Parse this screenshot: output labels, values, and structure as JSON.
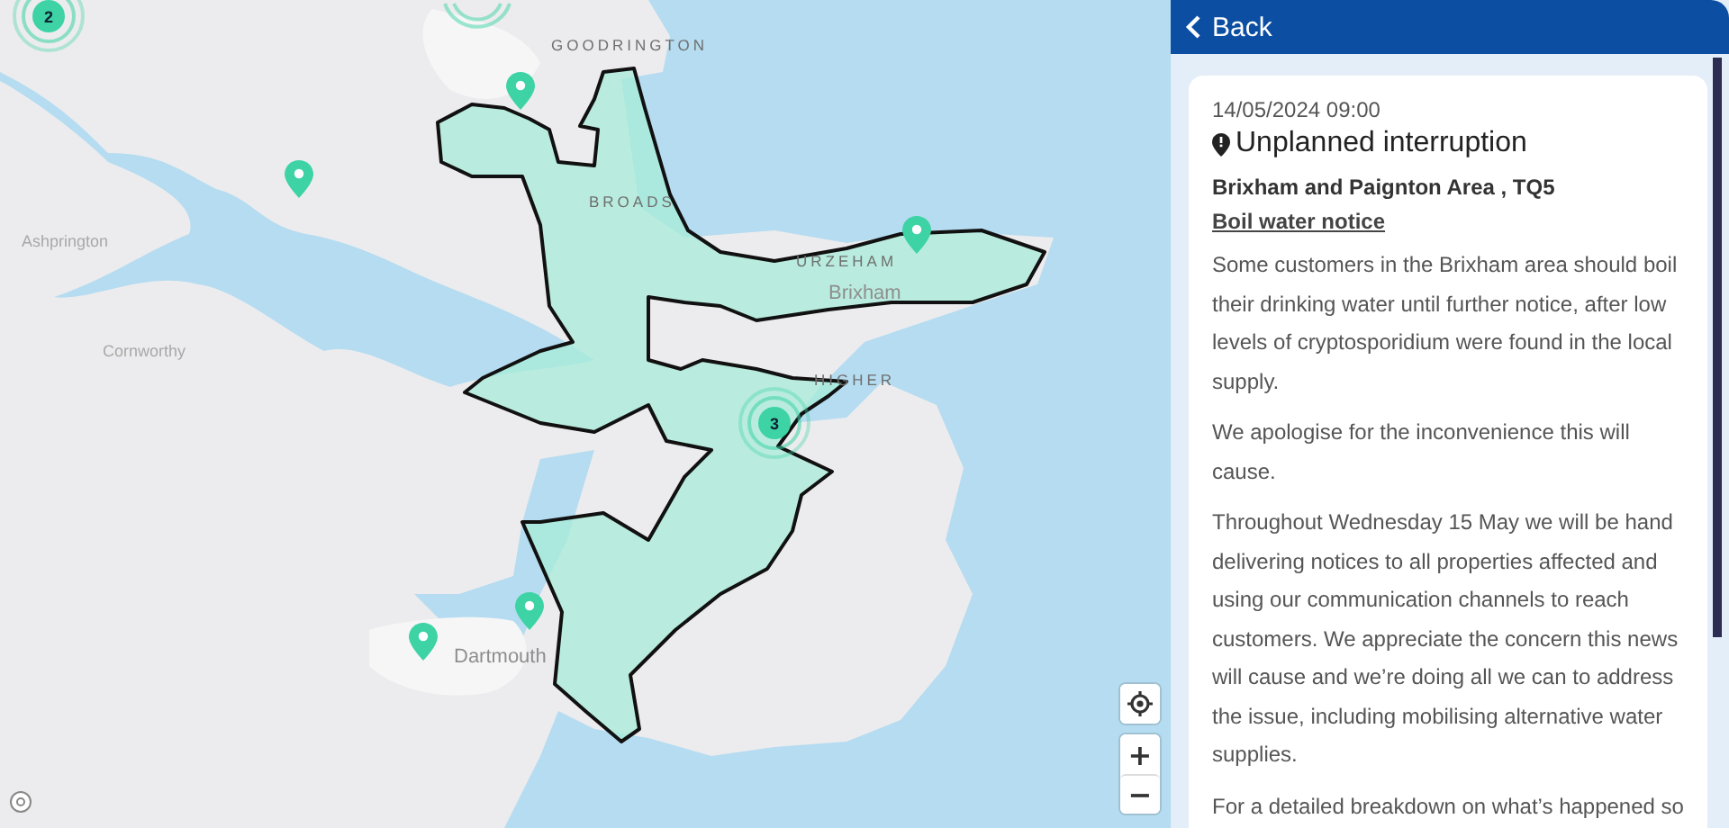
{
  "map": {
    "place_labels": [
      {
        "text": "GOODRINGTON",
        "kind": "district"
      },
      {
        "text": "BROADS",
        "kind": "district"
      },
      {
        "text": "Ashprington",
        "kind": "village"
      },
      {
        "text": "URZEHAM",
        "kind": "district"
      },
      {
        "text": "Brixham",
        "kind": "town"
      },
      {
        "text": "Cornworthy",
        "kind": "village"
      },
      {
        "text": "HIGHER",
        "kind": "district"
      },
      {
        "text": "Dartmouth",
        "kind": "town"
      }
    ],
    "clusters": [
      "2",
      "3"
    ],
    "controls": {
      "zoom_in": "+",
      "zoom_out": "−"
    }
  },
  "panel": {
    "back": "Back",
    "incident": {
      "date": "14/05/2024 09:00",
      "type": "Unplanned interruption",
      "area": "Brixham and Paignton Area , TQ5",
      "notice_link": "Boil water notice",
      "paragraphs": [
        "Some customers in the Brixham area should boil their drinking water until further notice, after low levels of cryptosporidium were found in the local supply.",
        "We apologise for the inconvenience this will cause.",
        "Throughout Wednesday 15 May we will be hand delivering notices to all properties affected and using our communication channels to reach customers. We appreciate the concern this news will cause and we’re doing all we can to address the issue, including mobilising alternative water supplies.",
        "For a detailed breakdown on what’s happened so"
      ]
    }
  }
}
